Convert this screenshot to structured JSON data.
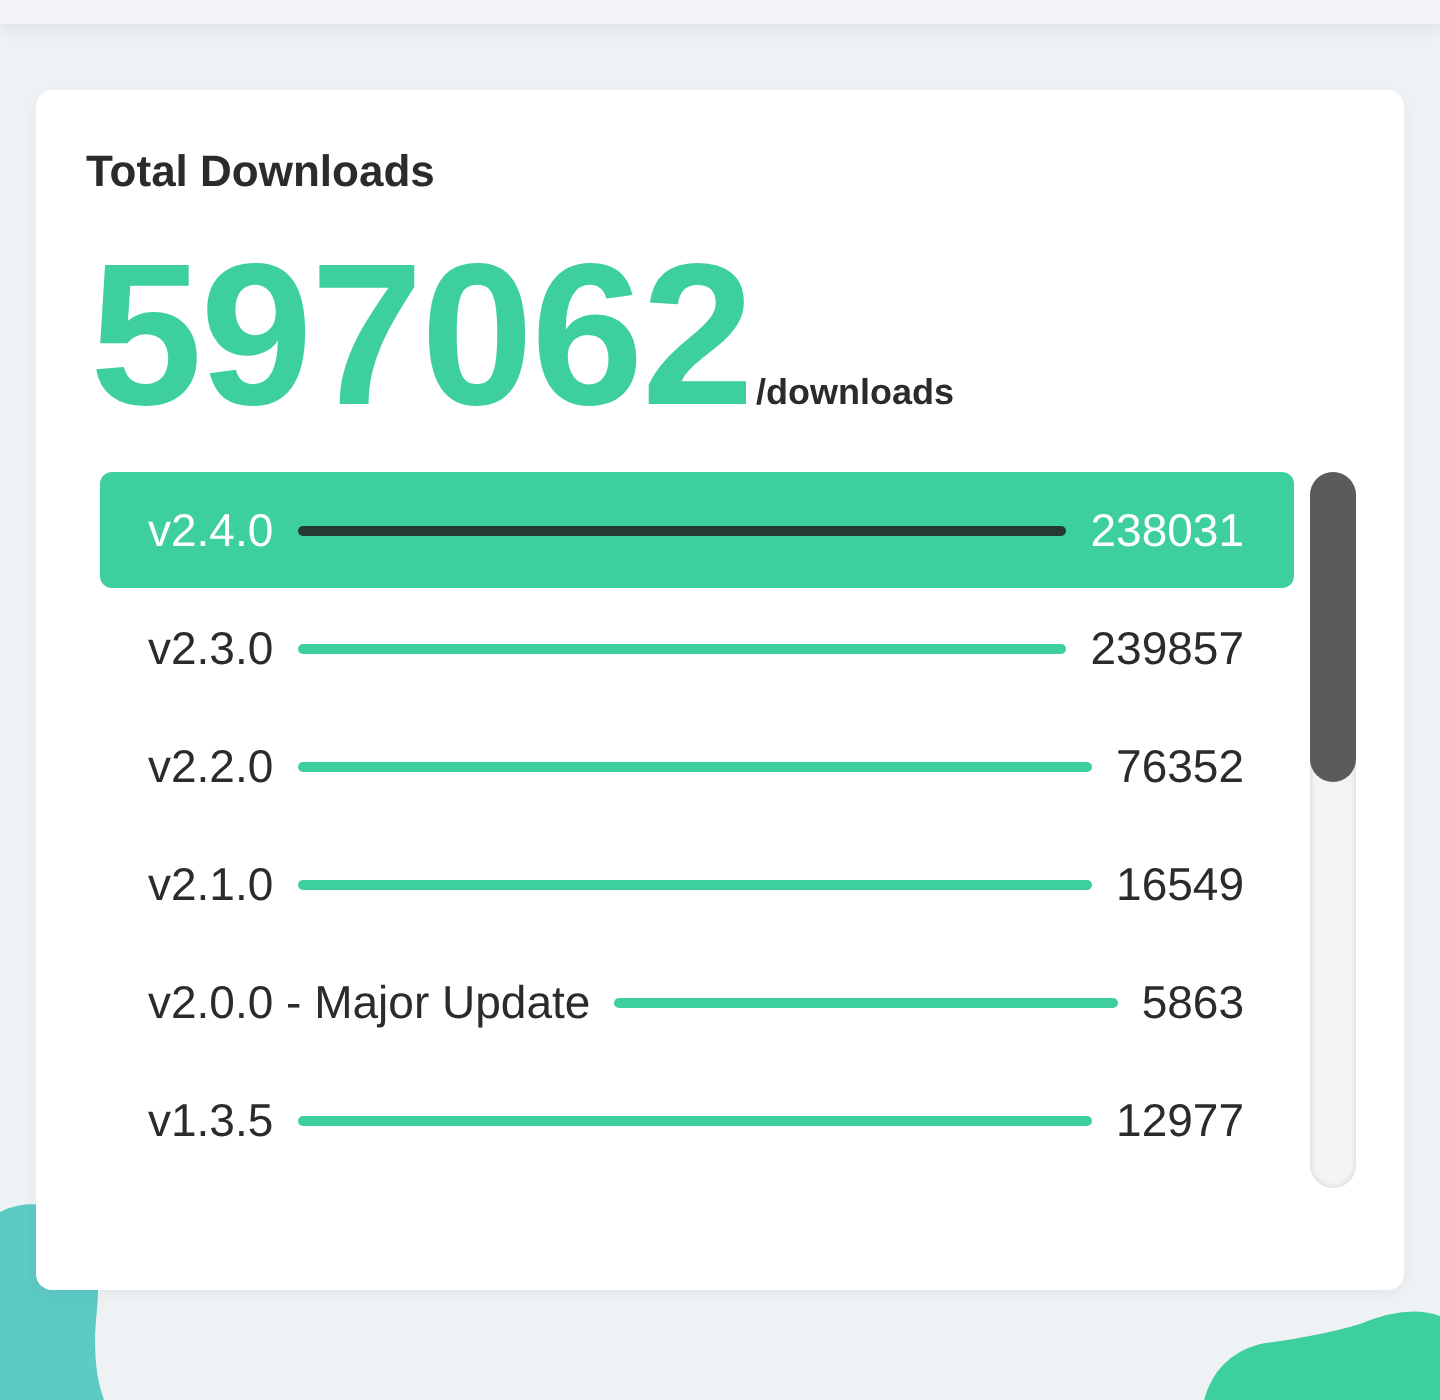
{
  "card": {
    "title": "Total Downloads",
    "total": "597062",
    "unit": "/downloads"
  },
  "versions": [
    {
      "name": "v2.4.0",
      "count": "238031",
      "selected": true
    },
    {
      "name": "v2.3.0",
      "count": "239857",
      "selected": false
    },
    {
      "name": "v2.2.0",
      "count": "76352",
      "selected": false
    },
    {
      "name": "v2.1.0",
      "count": "16549",
      "selected": false
    },
    {
      "name": "v2.0.0 - Major Update",
      "count": "5863",
      "selected": false
    },
    {
      "name": "v1.3.5",
      "count": "12977",
      "selected": false
    }
  ]
}
